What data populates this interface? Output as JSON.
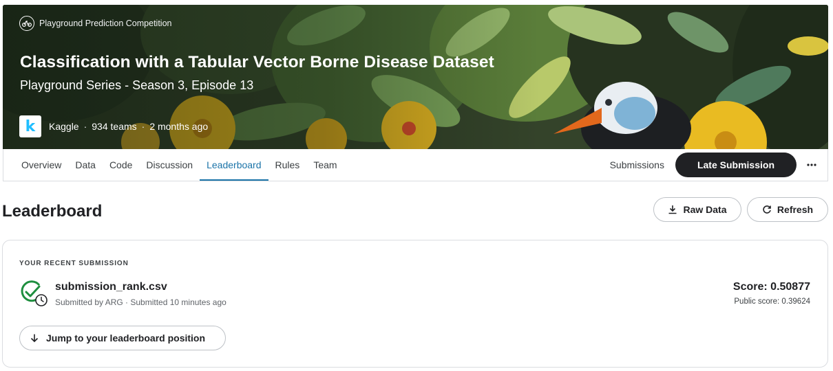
{
  "hero": {
    "tag": "Playground Prediction Competition",
    "tag_icon": "bicycle-icon",
    "title": "Classification with a Tabular Vector Borne Disease Dataset",
    "subtitle": "Playground Series - Season 3, Episode 13",
    "host": "Kaggle",
    "host_logo_letter": "k",
    "teams": "934 teams",
    "age": "2 months ago",
    "sep": "·"
  },
  "tabs": [
    {
      "label": "Overview",
      "active": false
    },
    {
      "label": "Data",
      "active": false
    },
    {
      "label": "Code",
      "active": false
    },
    {
      "label": "Discussion",
      "active": false
    },
    {
      "label": "Leaderboard",
      "active": true
    },
    {
      "label": "Rules",
      "active": false
    },
    {
      "label": "Team",
      "active": false
    }
  ],
  "actions": {
    "submissions": "Submissions",
    "late_submission": "Late Submission",
    "more_icon": "more-horizontal-icon"
  },
  "leaderboard": {
    "title": "Leaderboard",
    "raw_data": "Raw Data",
    "refresh": "Refresh"
  },
  "recent": {
    "label": "YOUR RECENT SUBMISSION",
    "filename": "submission_rank.csv",
    "meta": "Submitted by ARG · Submitted 10 minutes ago",
    "score": "Score: 0.50877",
    "public_score": "Public score: 0.39624",
    "jump": "Jump to your leaderboard position",
    "status_icon": "check-circle-clock-icon"
  },
  "colors": {
    "accent": "#1a73a8",
    "dark_button": "#202124",
    "success": "#1e8e3e",
    "kaggle_blue": "#20beff"
  }
}
